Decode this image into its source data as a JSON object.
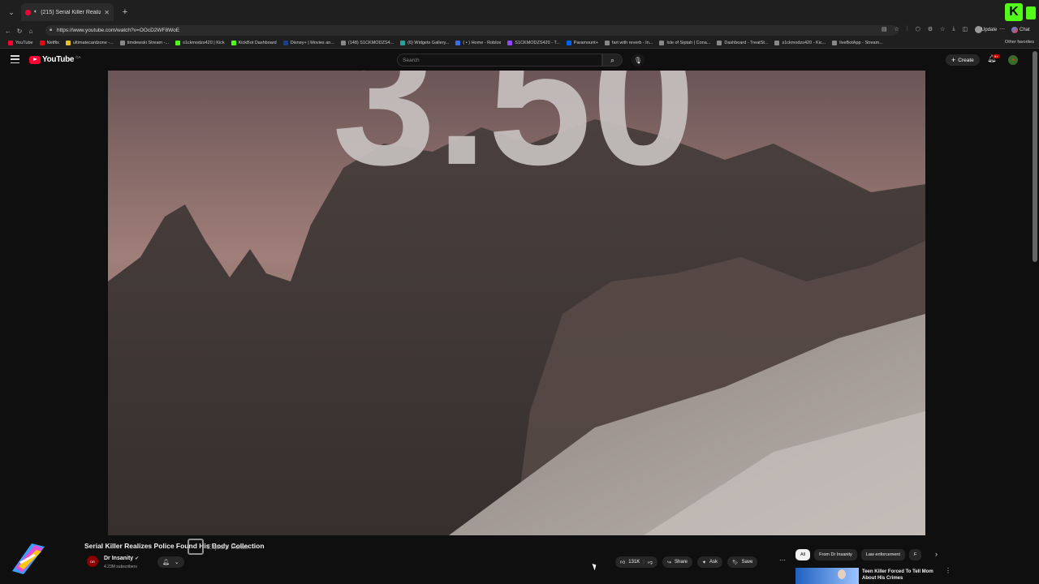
{
  "browser": {
    "tab_title": "(215) Serial Killer Realizes Pc",
    "url": "https://www.youtube.com/watch?v=OOcD2WF8WoE",
    "update_label": "Update",
    "chat_label": "Chat",
    "other_favorites": "Other favorites",
    "bookmarks": [
      {
        "label": "YouTube",
        "color": "#ff0033"
      },
      {
        "label": "Netflix",
        "color": "#e50914"
      },
      {
        "label": "ultimatecardzone -...",
        "color": "#e6c12a"
      },
      {
        "label": "timdewski Stream -...",
        "color": "#888888"
      },
      {
        "label": "s1ckmodzs420 | Kick",
        "color": "#53fc18"
      },
      {
        "label": "KickBot Dashboard",
        "color": "#53fc18"
      },
      {
        "label": "Disney+ | Movies an...",
        "color": "#1a3e8a"
      },
      {
        "label": "(148) S1CKMODZS4...",
        "color": "#888888"
      },
      {
        "label": "(6) Widgets Gallery...",
        "color": "#2aa198"
      },
      {
        "label": "( • ) Home - Roblox",
        "color": "#3a6ee8"
      },
      {
        "label": "S1CKMODZS420 - T...",
        "color": "#9146ff"
      },
      {
        "label": "Paramount+",
        "color": "#0064ff"
      },
      {
        "label": "fart with reverb - In...",
        "color": "#888888"
      },
      {
        "label": "Isle of Siptah | Cona...",
        "color": "#888888"
      },
      {
        "label": "Dashboard - TreatSt...",
        "color": "#888888"
      },
      {
        "label": "s1ckmodzs420 - Kic...",
        "color": "#888888"
      },
      {
        "label": "liveBotApp - Stream...",
        "color": "#888888"
      }
    ]
  },
  "youtube": {
    "logo_text": "YouTube",
    "country_code": "CA",
    "search_placeholder": "Search",
    "create_label": "Create",
    "notif_badge": "9+",
    "video": {
      "overlay_number": "3.50",
      "title": "Serial Killer Realizes Police Found His Body Collection",
      "watermark_text": "Explore Peran",
      "channel": "Dr Insanity",
      "subscribers": "4.23M subscribers",
      "likes": "131K",
      "share_label": "Share",
      "ask_label": "Ask",
      "save_label": "Save"
    },
    "chips": [
      "All",
      "From Dr Insanity",
      "Law enforcement",
      "F"
    ],
    "recommendation": {
      "title": "Teen Killer Forced To Tell Mom About His Crimes"
    }
  }
}
